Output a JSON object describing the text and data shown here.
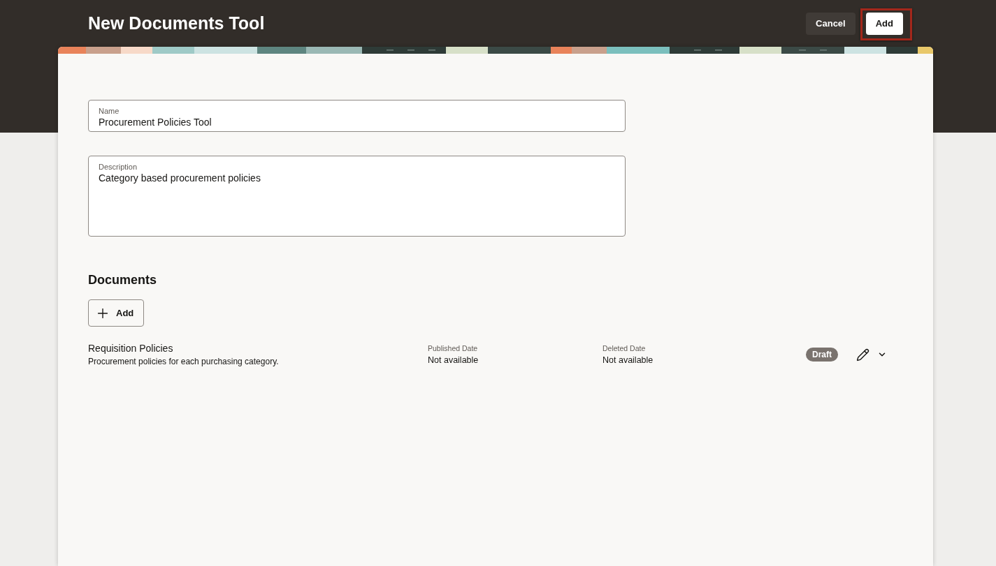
{
  "header": {
    "title": "New Documents Tool",
    "buttons": [
      {
        "label": "Cancel",
        "kind": "secondary",
        "highlighted": false
      },
      {
        "label": "Add",
        "kind": "primary",
        "highlighted": true
      }
    ]
  },
  "form": {
    "fields": [
      {
        "kind": "text",
        "label": "Name",
        "value": "Procurement Policies Tool"
      },
      {
        "kind": "textarea",
        "label": "Description",
        "value": "Category based procurement policies"
      }
    ]
  },
  "documents": {
    "heading": "Documents",
    "add_button": {
      "label": "Add"
    },
    "rows": [
      {
        "title": "Requisition Policies",
        "description": "Procurement policies for each purchasing category.",
        "columns": [
          {
            "label": "Published Date",
            "value": "Not available"
          },
          {
            "label": "Deleted Date",
            "value": "Not available"
          }
        ],
        "status": "Draft"
      }
    ]
  }
}
